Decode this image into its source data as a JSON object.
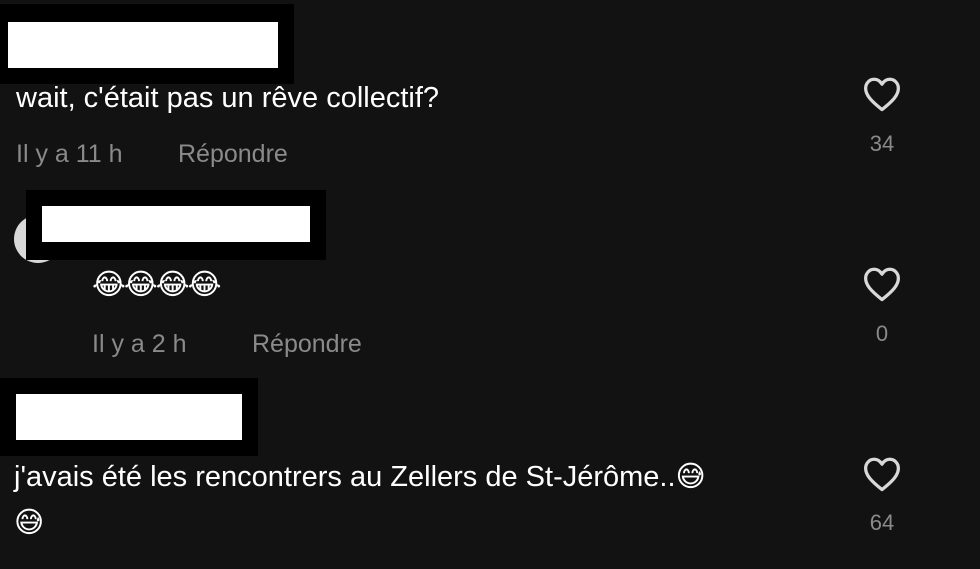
{
  "comments": [
    {
      "text": "wait, c'était pas un rêve collectif?",
      "time": "Il y a 11 h",
      "reply_label": "Répondre",
      "likes": "34"
    },
    {
      "text": "😂😂😂😂",
      "time": "Il y a 2 h",
      "reply_label": "Répondre",
      "likes": "0"
    },
    {
      "text_line1": "j'avais été les rencontrers au Zellers de St-Jérôme..😅",
      "text_line2": "😅",
      "likes": "64"
    }
  ]
}
